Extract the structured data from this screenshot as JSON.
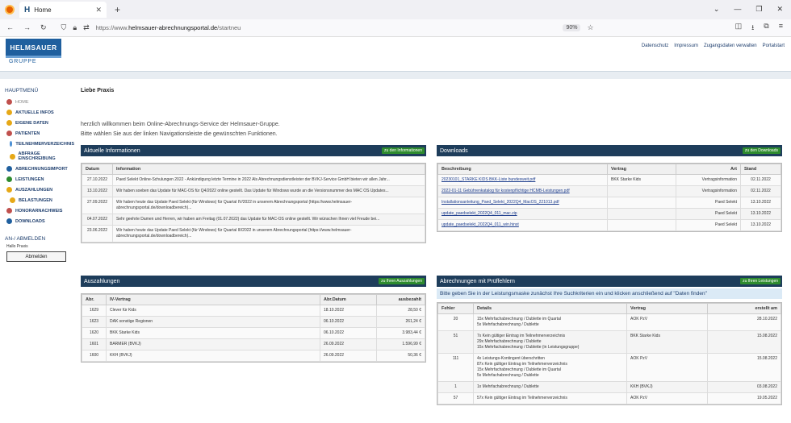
{
  "browser": {
    "tab_title": "Home",
    "url_prefix": "https://www.",
    "url_domain": "helmsauer-abrechnungsportal.de",
    "url_path": "/startneu",
    "zoom": "90%"
  },
  "logo": {
    "top": "HELMSAUER",
    "bottom": "GRUPPE"
  },
  "toplinks": [
    "Datenschutz",
    "Impressum",
    "Zugangsdaten verwalten",
    "Portalstart"
  ],
  "sidebar": {
    "title": "HAUPTMENÜ",
    "items": [
      {
        "label": "HOME",
        "cls": "home",
        "color": "#c0504d"
      },
      {
        "label": "AKTUELLE INFOS",
        "cls": "",
        "color": "#e6a817"
      },
      {
        "label": "EIGENE DATEN",
        "cls": "",
        "color": "#e6a817"
      },
      {
        "label": "PATIENTEN",
        "cls": "",
        "color": "#c0504d"
      },
      {
        "label": "TEILNEHMERVERZEICHNIS",
        "cls": "sub",
        "color": "#4a8fd4"
      },
      {
        "label": "ABFRAGE EINSCHREIBUNG",
        "cls": "sub",
        "color": "#e6a817"
      },
      {
        "label": "ABRECHNUNGSIMPORT",
        "cls": "",
        "color": "#1f5f9e"
      },
      {
        "label": "LEISTUNGEN",
        "cls": "",
        "color": "#2e8b2e"
      },
      {
        "label": "AUSZAHLUNGEN",
        "cls": "",
        "color": "#e6a817"
      },
      {
        "label": "BELASTUNGEN",
        "cls": "sub",
        "color": "#e6a817"
      },
      {
        "label": "HONORARNACHWEIS",
        "cls": "",
        "color": "#c0504d"
      },
      {
        "label": "DOWNLOADS",
        "cls": "",
        "color": "#1f5f9e"
      }
    ],
    "login_title": "AN-/ ABMELDEN",
    "user": "Hallo Praxis",
    "logout": "Abmelden"
  },
  "main": {
    "greeting": "Liebe Praxis",
    "intro1": "herzlich willkommen beim Online-Abrechnungs-Service der Helmsauer-Gruppe.",
    "intro2": "Bitte wählen Sie aus der linken Navigationsleiste die gewünschten Funktionen."
  },
  "infos": {
    "title": "Aktuelle Informationen",
    "btn": "zu den Informationen",
    "cols": [
      "Datum",
      "Information"
    ],
    "rows": [
      [
        "27.10.2022",
        "Paed Selekt Online-Schulungen 2022 - Ankündigung letzte Termine in 2022 Als Abrechnungsdienstleister der BVKJ-Service GmbH bieten wir allen Jahr..."
      ],
      [
        "13.10.2022",
        "Wir haben soeben das Update für MAC-OS für Q4/2022 online gestellt. Das Update für Windows wurde an die Versionsnummer des MAC OS Updates..."
      ],
      [
        "27.09.2022",
        "Wir haben heute das Update Paed Selekt (für Windows) für Quartal IV/2022 in unserem Abrechnungsportal (https://www.helmsauer-abrechnungsportal.de/downloadbereich)..."
      ],
      [
        "04.07.2022",
        "Sehr geehrte Damen und Herren, wir haben am Freitag (01.07.2022) das Update für MAC-OS online gestellt. Wir wünschen Ihnen viel Freude bei..."
      ],
      [
        "23.06.2022",
        "Wir haben heute das Update Paed Selekt (für Windows) für Quartal III/2022 in unserem Abrechnungsportal (https://www.helmsauer-abrechnungsportal.de/downloadbereich)..."
      ]
    ]
  },
  "downloads": {
    "title": "Downloads",
    "btn": "zu den Downloads",
    "cols": [
      "Beschreibung",
      "Vertrag",
      "Art",
      "Stand"
    ],
    "rows": [
      [
        "20230101_STARKE KIDS BKK-Liste bundesweit.pdf",
        "BKK Starke Kids",
        "Vertragsinformation",
        "02.11.2022"
      ],
      [
        "2022-01-11 Gebührenkatalog für kostenpflichtige HCMB-Leistungen.pdf",
        "",
        "Vertragsinformation",
        "02.11.2022"
      ],
      [
        "Installationsanleitung_Paed_Selekt_2022Q4_MacOS_221013.pdf",
        "",
        "Paed Selekt",
        "13.10.2022"
      ],
      [
        "update_paedselekt_2022Q4_011_mac.zip",
        "",
        "Paed Selekt",
        "13.10.2022"
      ],
      [
        "update_paedselekt_2022Q4_011_win.hinst",
        "",
        "Paed Selekt",
        "13.10.2022"
      ]
    ]
  },
  "payouts": {
    "title": "Auszahlungen",
    "btn": "zu Ihren Auszahlungen",
    "cols": [
      "Abr.",
      "IV-Vertrag",
      "Abr.Datum",
      "ausbezahlt"
    ],
    "rows": [
      [
        "1629",
        "Clever für Kids",
        "18.10.2022",
        "28,50 €"
      ],
      [
        "1623",
        "DAK sonstige Regionen",
        "06.10.2022",
        "261,24 €"
      ],
      [
        "1620",
        "BKK Starke Kids",
        "06.10.2022",
        "3.983,44 €"
      ],
      [
        "1601",
        "BARMER (BVKJ)",
        "26.09.2022",
        "1.596,99 €"
      ],
      [
        "1600",
        "KKH (BVKJ)",
        "26.09.2022",
        "50,36 €"
      ]
    ]
  },
  "errors": {
    "title": "Abrechnungen mit Prüffehlern",
    "btn": "zu Ihren Leistungen",
    "hint": "Bitte geben Sie in der Leistungsmaske zunächst Ihre Suchkriterien ein und klicken anschließend auf \"Daten finden\"",
    "cols": [
      "Fehler",
      "Details",
      "Vertrag",
      "erstellt am"
    ],
    "rows": [
      [
        "20",
        "15x Mehrfachabrechnung / Dublette im Quartal\n5x Mehrfachabrechnung / Dublette",
        "AOK PzV",
        "28.10.2022"
      ],
      [
        "51",
        "7x Kein gültiger Eintrag im Teilnehmerverzeichnis\n29x Mehrfachabrechnung / Dublette\n15x Mehrfachabrechnung / Dublette (in Leistungsgruppe)",
        "BKK Starke Kids",
        "15.08.2022"
      ],
      [
        "111",
        "4x Leistungs-Kontingent überschritten\n87x Kein gültiger Eintrag im Teilnehmerverzeichnis\n15x Mehrfachabrechnung / Dublette im Quartal\n5x Mehrfachabrechnung / Dublette",
        "AOK PzV",
        "15.08.2022"
      ],
      [
        "1",
        "1x Mehrfachabrechnung / Dublette",
        "KKH (BVKJ)",
        "03.08.2022"
      ],
      [
        "57",
        "57x Kein gültiger Eintrag im Teilnehmerverzeichnis",
        "AOK PzV",
        "19.05.2022"
      ]
    ]
  }
}
